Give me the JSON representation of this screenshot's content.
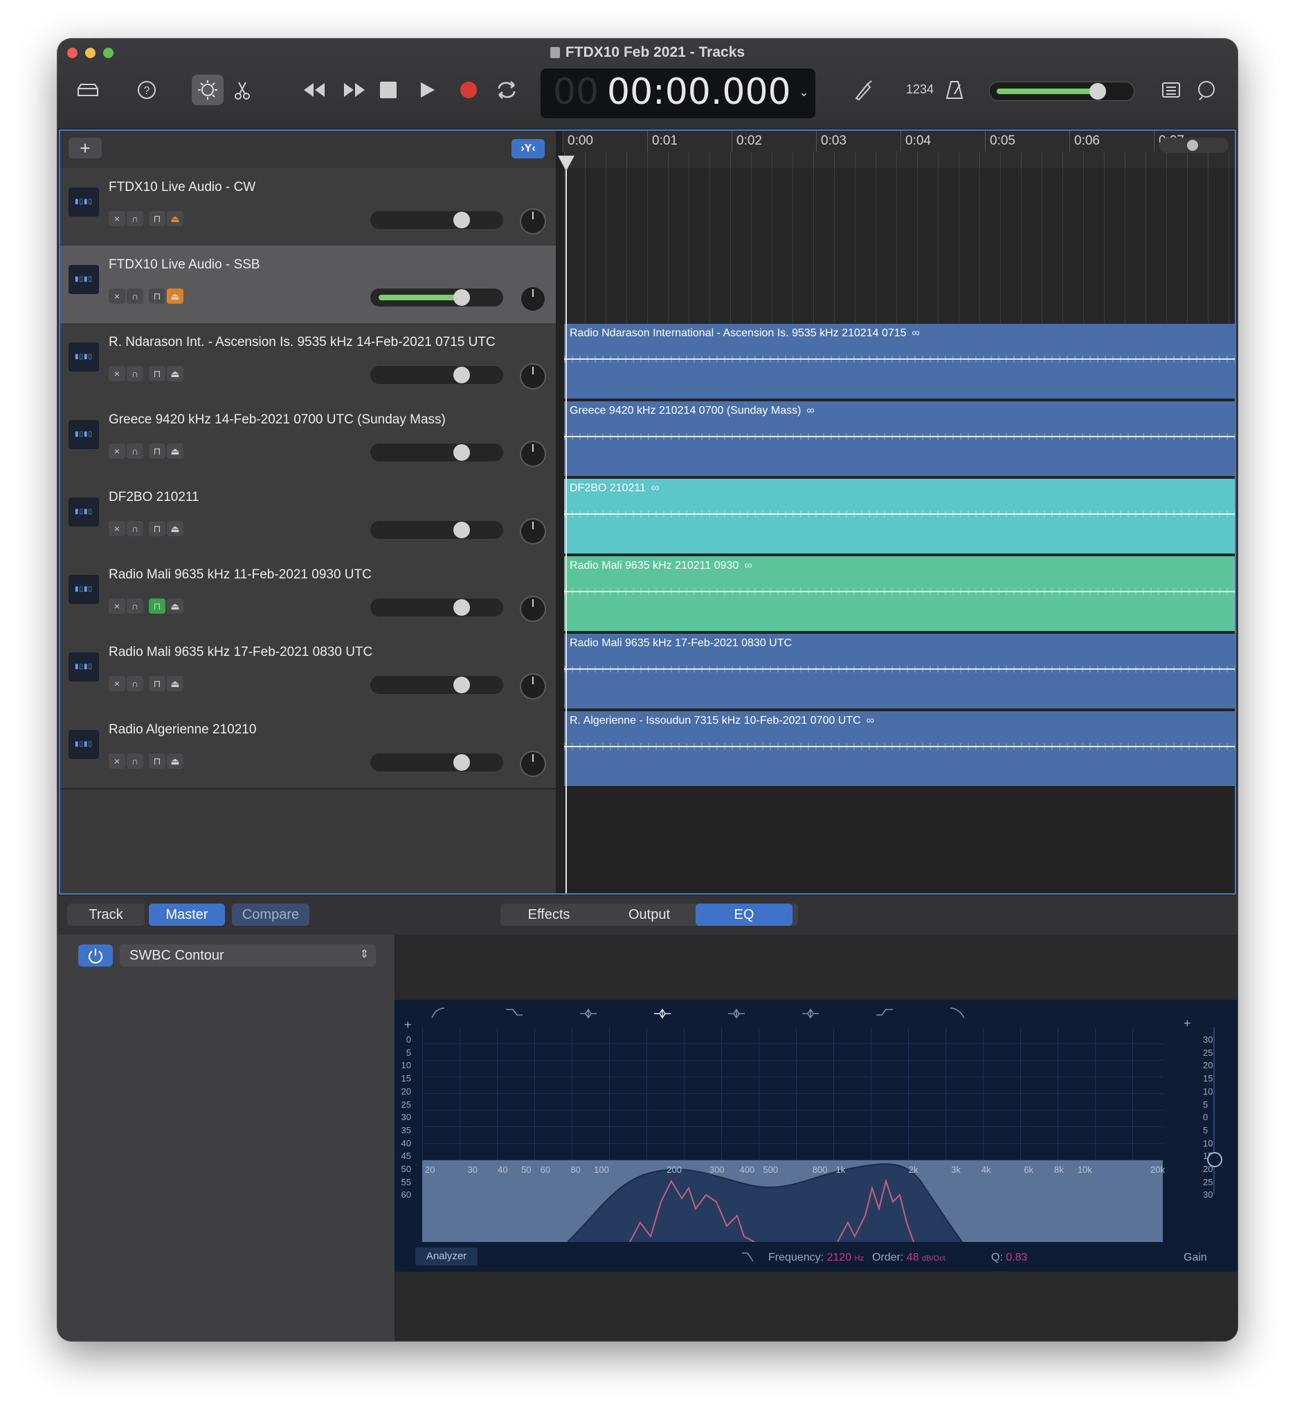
{
  "window": {
    "title": "FTDX10 Feb 2021 - Tracks",
    "traffic_lights": [
      "#ed5f57",
      "#f4be4f",
      "#5fc453"
    ]
  },
  "toolbar": {
    "library_icon": "library-icon",
    "help_icon": "help-icon",
    "smart_controls_icon": "smart-controls-icon",
    "editors_icon": "scissors-icon",
    "rewind_icon": "rewind-icon",
    "forward_icon": "fast-forward-icon",
    "stop_icon": "stop-icon",
    "play_icon": "play-icon",
    "record_icon": "record-icon",
    "cycle_icon": "cycle-icon",
    "lcd_ghost": "00",
    "lcd_time": "00:00.000",
    "tuner_icon": "tuner-icon",
    "count_in": "1234",
    "metronome_icon": "metronome-icon",
    "master_volume": 0.78,
    "notepad_icon": "notepad-icon",
    "loops_icon": "loops-icon",
    "accent": "#d93a34"
  },
  "tracks_header": {
    "add_label": "+",
    "filter_label": "›Y‹"
  },
  "ruler": [
    "0:00",
    "0:01",
    "0:02",
    "0:03",
    "0:04",
    "0:05",
    "0:06",
    "0:07"
  ],
  "tracks": [
    {
      "name": "FTDX10 Live Audio - CW",
      "volume": 0.72,
      "selected": false,
      "lock_active": false,
      "record_active": true,
      "region": null
    },
    {
      "name": "FTDX10 Live Audio - SSB",
      "volume": 0.72,
      "selected": true,
      "lock_active": false,
      "record_active": true,
      "region": null
    },
    {
      "name": "R. Ndarason Int. - Ascension Is. 9535 kHz 14-Feb-2021 0715 UTC",
      "volume": 0.72,
      "selected": false,
      "lock_active": false,
      "record_active": false,
      "region": {
        "label": "Radio Ndarason International - Ascension Is. 9535 kHz 210214 0715",
        "color": "#4a6fa8",
        "loop": true
      }
    },
    {
      "name": "Greece 9420 kHz 14-Feb-2021 0700 UTC (Sunday Mass)",
      "volume": 0.72,
      "selected": false,
      "lock_active": false,
      "record_active": false,
      "region": {
        "label": "Greece 9420 kHz 210214 0700 (Sunday Mass)",
        "color": "#4a6fa8",
        "loop": true
      }
    },
    {
      "name": "DF2BO 210211",
      "volume": 0.72,
      "selected": false,
      "lock_active": false,
      "record_active": false,
      "region": {
        "label": "DF2BO 210211",
        "color": "#5cc7c8",
        "loop": true
      }
    },
    {
      "name": "Radio Mali 9635 kHz 11-Feb-2021 0930 UTC",
      "volume": 0.72,
      "selected": false,
      "lock_active": true,
      "record_active": false,
      "region": {
        "label": "Radio Mali 9635 kHz 210211 0930",
        "color": "#5bc49b",
        "loop": true
      }
    },
    {
      "name": "Radio Mali 9635 kHz 17-Feb-2021 0830 UTC",
      "volume": 0.72,
      "selected": false,
      "lock_active": false,
      "record_active": false,
      "region": {
        "label": "Radio Mali 9635 kHz 17-Feb-2021 0830 UTC",
        "color": "#4a6fa8",
        "loop": false
      }
    },
    {
      "name": "Radio Algerienne 210210",
      "volume": 0.72,
      "selected": false,
      "lock_active": false,
      "record_active": false,
      "region": {
        "label": "R. Algerienne - Issoudun  7315 kHz 10-Feb-2021 0700 UTC",
        "color": "#4a6fa8",
        "loop": true
      }
    }
  ],
  "editor": {
    "tabs_left": [
      "Track",
      "Master",
      "Compare"
    ],
    "tabs_left_selected": "Master",
    "tabs_right": [
      "Effects",
      "Output",
      "EQ"
    ],
    "tabs_right_selected": "EQ",
    "preset": "SWBC Contour",
    "power_icon": "power-icon"
  },
  "eq": {
    "left_plus": "+",
    "right_plus": "+",
    "left_scale": [
      "0",
      "5",
      "10",
      "15",
      "20",
      "25",
      "30",
      "35",
      "40",
      "45",
      "50",
      "55",
      "60"
    ],
    "right_scale": [
      "30",
      "25",
      "20",
      "15",
      "10",
      "5",
      "0",
      "5",
      "10",
      "15",
      "20",
      "25",
      "30"
    ],
    "freq_labels": [
      "20",
      "30",
      "40",
      "50",
      "60",
      "80",
      "100",
      "200",
      "300",
      "400",
      "500",
      "800",
      "1k",
      "2k",
      "3k",
      "4k",
      "6k",
      "8k",
      "10k",
      "20k"
    ],
    "band_icons": [
      "low-cut-icon",
      "low-shelf-icon",
      "bell-icon",
      "bell-icon",
      "bell-icon",
      "bell-icon",
      "high-shelf-icon",
      "high-cut-icon"
    ],
    "analyzer_label": "Analyzer",
    "frequency_label": "Frequency:",
    "frequency_value": "2120",
    "frequency_unit": "Hz",
    "order_label": "Order:",
    "order_value": "48",
    "order_unit": "dB/Oct",
    "q_label": "Q:",
    "q_value": "0.83",
    "gain_label": "Gain"
  }
}
